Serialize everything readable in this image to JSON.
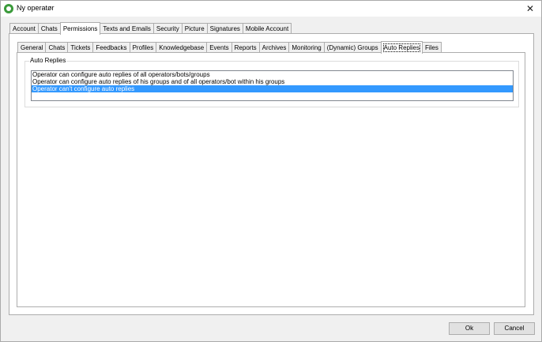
{
  "window": {
    "title": "Ny operatør",
    "close_glyph": "✕",
    "icons": {
      "app": "app-logo-icon",
      "close": "close-icon"
    }
  },
  "outer_tabs": [
    {
      "label": "Account",
      "active": false
    },
    {
      "label": "Chats",
      "active": false
    },
    {
      "label": "Permissions",
      "active": true
    },
    {
      "label": "Texts and Emails",
      "active": false
    },
    {
      "label": "Security",
      "active": false
    },
    {
      "label": "Picture",
      "active": false
    },
    {
      "label": "Signatures",
      "active": false
    },
    {
      "label": "Mobile Account",
      "active": false
    }
  ],
  "inner_tabs": [
    {
      "label": "General",
      "active": false
    },
    {
      "label": "Chats",
      "active": false
    },
    {
      "label": "Tickets",
      "active": false
    },
    {
      "label": "Feedbacks",
      "active": false
    },
    {
      "label": "Profiles",
      "active": false
    },
    {
      "label": "Knowledgebase",
      "active": false
    },
    {
      "label": "Events",
      "active": false
    },
    {
      "label": "Reports",
      "active": false
    },
    {
      "label": "Archives",
      "active": false
    },
    {
      "label": "Monitoring",
      "active": false
    },
    {
      "label": "(Dynamic) Groups",
      "active": false
    },
    {
      "label": "Auto Replies",
      "active": true
    },
    {
      "label": "Files",
      "active": false
    }
  ],
  "auto_replies": {
    "legend": "Auto Replies",
    "options": [
      {
        "label": "Operator can configure auto replies of all operators/bots/groups",
        "selected": false
      },
      {
        "label": "Operator can configure auto replies of his groups and of all operators/bot within his groups",
        "selected": false
      },
      {
        "label": "Operator can't configure auto replies",
        "selected": true
      }
    ]
  },
  "buttons": {
    "ok": "Ok",
    "cancel": "Cancel"
  },
  "colors": {
    "selection": "#3399ff",
    "app_icon": "#3a9a3a"
  }
}
